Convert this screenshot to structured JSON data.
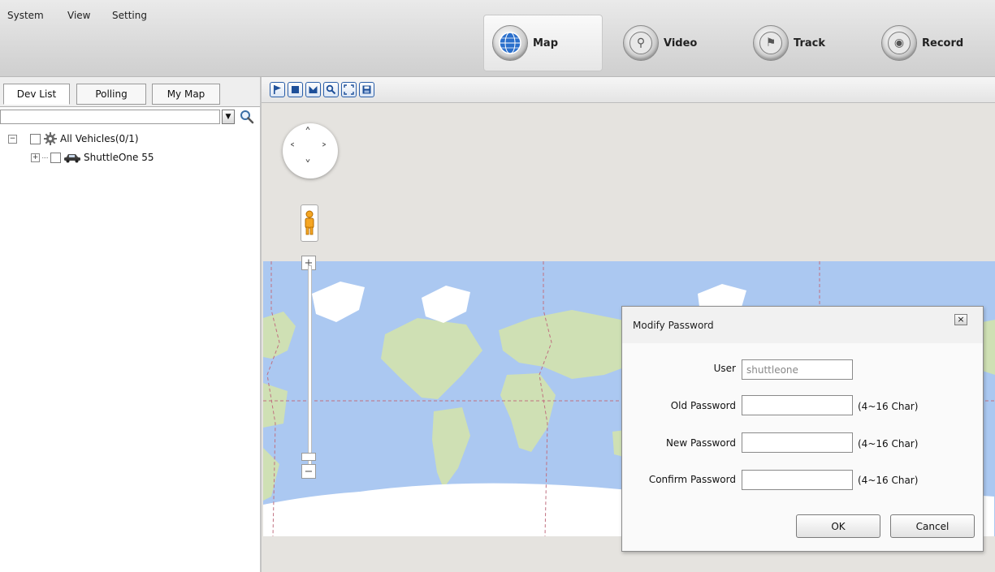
{
  "menu": {
    "items": [
      "System",
      "View",
      "Setting"
    ]
  },
  "nav": {
    "map_label": "Map",
    "video_label": "Video",
    "track_label": "Track",
    "record_label": "Record",
    "active": "Map"
  },
  "left_panel": {
    "tabs": [
      "Dev List",
      "Polling",
      "My Map"
    ],
    "active_tab": "Dev List",
    "search": {
      "value": "",
      "placeholder": ""
    },
    "tree": {
      "root_label": "All Vehicles(0/1)",
      "children": [
        {
          "label": "ShuttleOne 55"
        }
      ]
    }
  },
  "map": {
    "toolbar_icons": [
      "flag-icon",
      "stop-icon",
      "polygon-icon",
      "magnify-icon",
      "fit-view-icon",
      "save-icon"
    ]
  },
  "dialog": {
    "title": "Modify Password",
    "close_glyph": "×",
    "fields": {
      "user_label": "User",
      "user_value": "shuttleone",
      "old_label": "Old Password",
      "new_label": "New Password",
      "confirm_label": "Confirm Password",
      "hint": "(4~16 Char)"
    },
    "ok_label": "OK",
    "cancel_label": "Cancel"
  },
  "colors": {
    "accent_blue": "#2a5ea8",
    "ocean": "#abc8f1",
    "land": "#cfe0b4"
  }
}
